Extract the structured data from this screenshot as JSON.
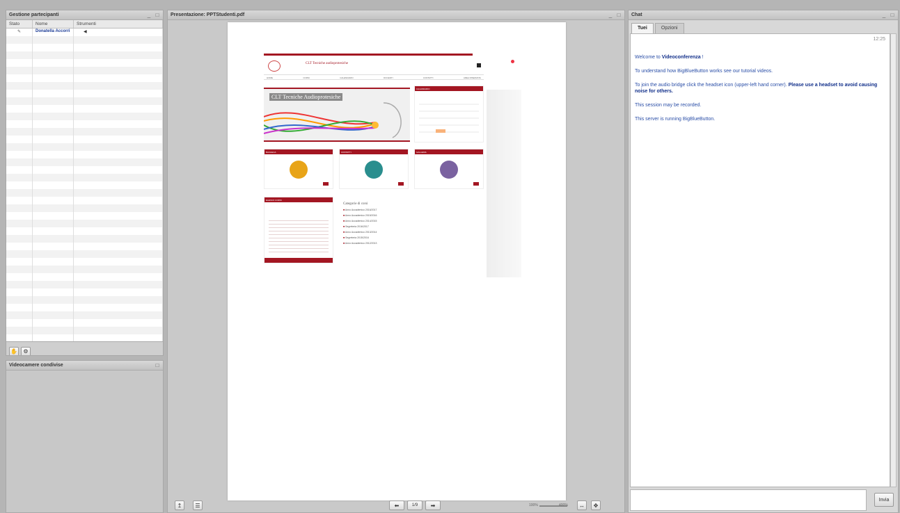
{
  "participants": {
    "title": "Gestione partecipanti",
    "cols": [
      "Stato",
      "Nome",
      "Strumenti"
    ],
    "rows": [
      {
        "name": "Donatella Accorri"
      }
    ]
  },
  "webcams": {
    "title": "Videocamere condivise"
  },
  "presentation": {
    "title": "Presentazione: PPTStudenti.pdf",
    "page": "1/9",
    "zoom_left": "100%",
    "zoom_right": "400%",
    "slide": {
      "header_title": "CLT Tecniche audioprotesiche",
      "banner_text": "CLT Tecniche Audioprotesiche",
      "calendar_title": "CALENDARIO",
      "box1_title": "BACHECA",
      "box2_title": "CONTATTI",
      "box3_title": "GALLERIA",
      "subjects_title": "ELENCO CORSI",
      "categories_title": "Categorie di corsi",
      "categories": [
        "Anno Accademico 2016/2017",
        "Anno Accademico 2015/2016",
        "Anno Accademico 2014/2015",
        "Segreteria 2016/2017",
        "Anno Accademico 2013/2014",
        "Segreteria 2015/2016",
        "Anno Accademico 2012/2013"
      ],
      "menu": [
        "HOME",
        "CORSI",
        "CALENDARIO",
        "DOCENTI",
        "CONTATTI",
        "AREA RISERVATA"
      ]
    }
  },
  "chat": {
    "title": "Chat",
    "tabs": [
      "Tuei",
      "Opzioni"
    ],
    "time": "12:25",
    "messages": [
      {
        "pre": "Welcome to ",
        "bold": "Videoconferenza",
        "post": " !"
      },
      {
        "pre": "To understand how BigBlueButton works see our tutorial videos.",
        "bold": "",
        "post": ""
      },
      {
        "pre": "To join the audio bridge click the headset icon (upper-left hand corner). ",
        "bold": "Please use a headset to avoid causing noise for others.",
        "post": ""
      },
      {
        "pre": "This session may be recorded.",
        "bold": "",
        "post": ""
      },
      {
        "pre": "This server is running BigBlueButton.",
        "bold": "",
        "post": ""
      }
    ],
    "send_label": "Invia"
  },
  "colors": {
    "brand_red": "#a31622",
    "link_blue": "#1b3b95"
  }
}
